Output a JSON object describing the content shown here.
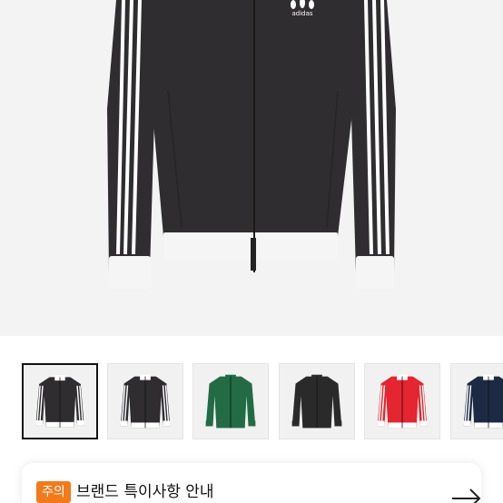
{
  "product": {
    "main_image": "adidas-black-track-jacket",
    "brand_text": "adidas"
  },
  "thumbnails": [
    {
      "label": "Black track jacket (front)",
      "color": "#2f2d30",
      "stripes": "#ffffff",
      "cuffs": "#ffffff",
      "selected": true
    },
    {
      "label": "Black track jacket (alt view)",
      "color": "#2f2d30",
      "stripes": "#ffffff",
      "cuffs": "#ffffff",
      "selected": false
    },
    {
      "label": "Green track jacket",
      "color": "#226b45",
      "stripes": "#226b45",
      "cuffs": "#226b45",
      "selected": false
    },
    {
      "label": "Black track jacket (dark trim)",
      "color": "#2a2a2a",
      "stripes": "#2a2a2a",
      "cuffs": "#2a2a2a",
      "selected": false
    },
    {
      "label": "Red track jacket",
      "color": "#e5252f",
      "stripes": "#ffffff",
      "cuffs": "#ffffff",
      "selected": false
    },
    {
      "label": "Navy track jacket",
      "color": "#1d2a44",
      "stripes": "#ffffff",
      "cuffs": "#ffffff",
      "selected": false
    }
  ],
  "notice": {
    "badge": "주의",
    "title": "브랜드 특이사항 안내",
    "arrow_icon": "arrow-right-icon"
  },
  "colors": {
    "badge": "#f27a1a",
    "hero_bg": "#f3f3f3"
  }
}
